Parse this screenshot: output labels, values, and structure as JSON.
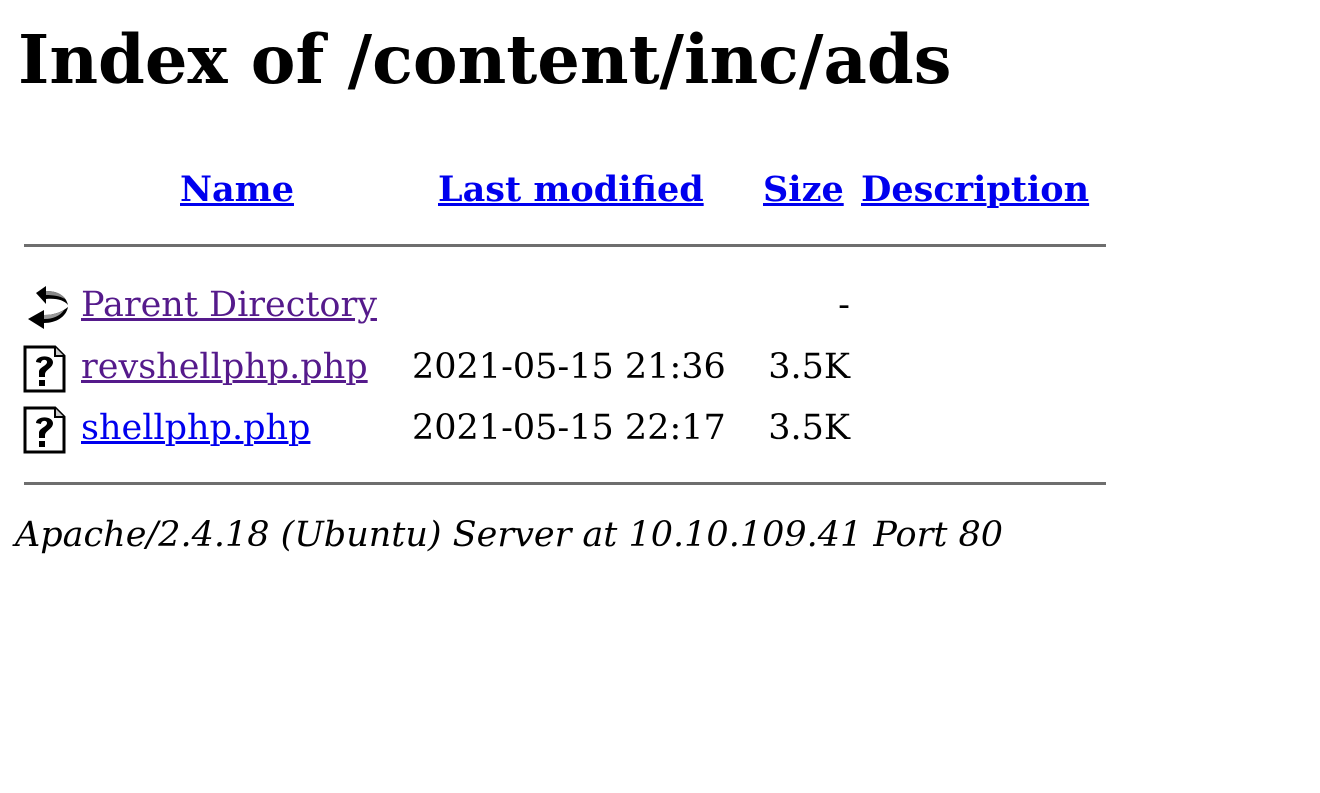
{
  "page": {
    "title": "Index of /content/inc/ads"
  },
  "columns": {
    "name": "Name",
    "last_modified": "Last modified",
    "size": "Size",
    "description": "Description"
  },
  "entries": [
    {
      "icon": "back-icon",
      "name": "Parent Directory",
      "last_modified": "",
      "size": "-",
      "description": "",
      "visited": true
    },
    {
      "icon": "unknown-file-icon",
      "name": "revshellphp.php",
      "last_modified": "2021-05-15 21:36",
      "size": "3.5K",
      "description": "",
      "visited": true
    },
    {
      "icon": "unknown-file-icon",
      "name": "shellphp.php",
      "last_modified": "2021-05-15 22:17",
      "size": "3.5K",
      "description": "",
      "visited": false
    }
  ],
  "footer": {
    "server_signature": "Apache/2.4.18 (Ubuntu) Server at 10.10.109.41 Port 80"
  },
  "colors": {
    "link": "#0000ee",
    "visited_link": "#551a8b",
    "rule": "#6e6e6e"
  }
}
